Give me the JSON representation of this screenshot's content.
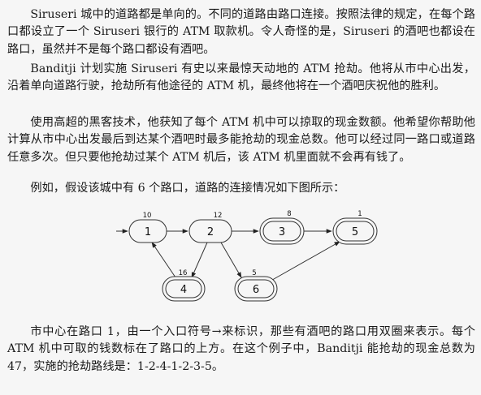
{
  "paragraphs": [
    "Siruseri 城中的道路都是单向的。不同的道路由路口连接。按照法律的规定，在每个路口都设立了一个 Siruseri 银行的 ATM 取款机。令人奇怪的是，Siruseri 的酒吧也都设在路口，虽然并不是每个路口都设有酒吧。",
    "Banditji 计划实施 Siruseri 有史以来最惊天动地的 ATM 抢劫。他将从市中心出发，沿着单向道路行驶，抢劫所有他途径的 ATM 机，最终他将在一个酒吧庆祝他的胜利。",
    "使用高超的黑客技术，他获知了每个 ATM 机中可以掠取的现金数额。他希望你帮助他计算从市中心出发最后到达某个酒吧时最多能抢劫的现金总数。他可以经过同一路口或道路任意多次。但只要他抢劫过某个 ATM 机后，该 ATM 机里面就不会再有钱了。",
    "例如，假设该城中有 6 个路口，道路的连接情况如下图所示：",
    "市中心在路口 1，由一个入口符号→来标识，那些有酒吧的路口用双圈来表示。每个 ATM 机中可取的钱数标在了路口的上方。在这个例子中，Banditji 能抢劫的现金总数为 47，实施的抢劫路线是：1-2-4-1-2-3-5。"
  ],
  "graph": {
    "nodes": [
      {
        "id": "1",
        "cash": "10",
        "bar": false
      },
      {
        "id": "2",
        "cash": "12",
        "bar": false
      },
      {
        "id": "3",
        "cash": "8",
        "bar": true
      },
      {
        "id": "5",
        "cash": "1",
        "bar": true
      },
      {
        "id": "4",
        "cash": "16",
        "bar": true
      },
      {
        "id": "6",
        "cash": "5",
        "bar": true
      }
    ],
    "edges": [
      [
        "entry",
        "1"
      ],
      [
        "1",
        "2"
      ],
      [
        "2",
        "3"
      ],
      [
        "3",
        "5"
      ],
      [
        "2",
        "4"
      ],
      [
        "4",
        "1"
      ],
      [
        "2",
        "6"
      ],
      [
        "6",
        "5"
      ]
    ],
    "start": "1"
  }
}
